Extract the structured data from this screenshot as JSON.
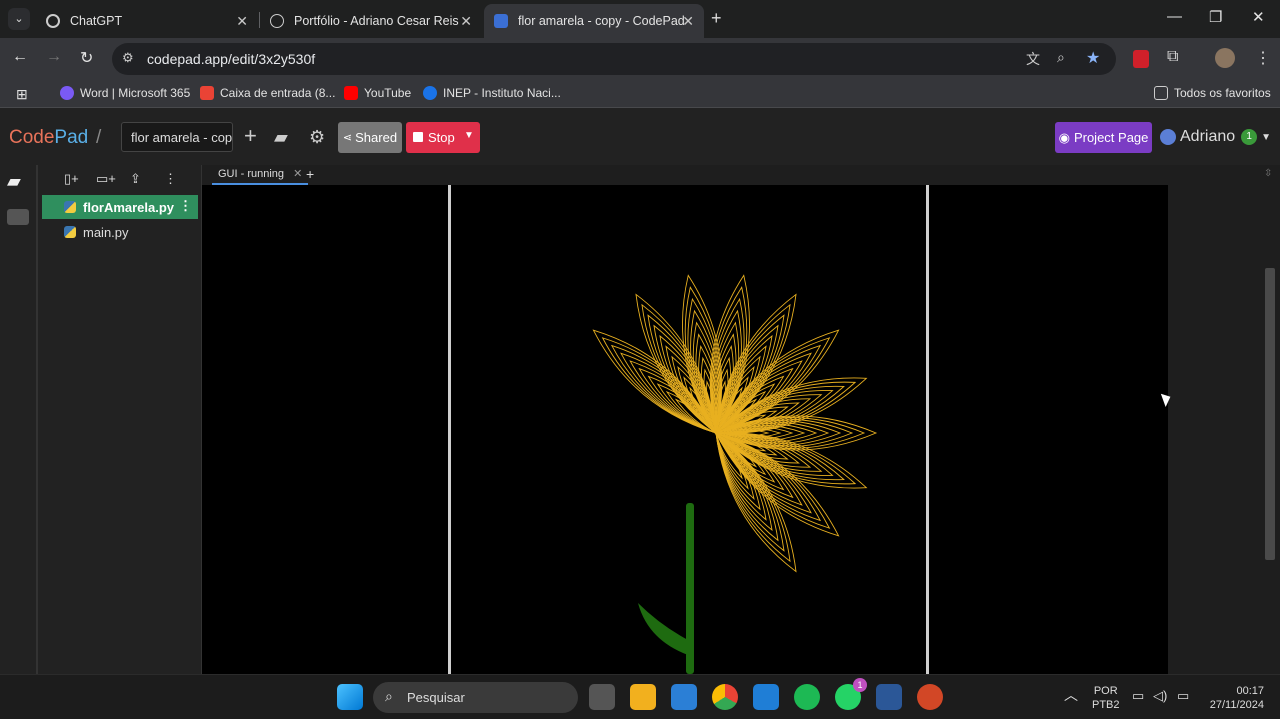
{
  "browser": {
    "tabs": [
      {
        "title": "ChatGPT",
        "icon": "chatgpt-icon"
      },
      {
        "title": "Portfólio - Adriano Cesar Reis",
        "icon": "globe-icon"
      },
      {
        "title": "flor amarela - copy - CodePad",
        "icon": "codepad-icon",
        "active": true
      }
    ],
    "url": "codepad.app/edit/3x2y530f",
    "bookmarks": [
      {
        "label": "Word | Microsoft 365",
        "color": "#7a5af5"
      },
      {
        "label": "Caixa de entrada (8...",
        "color": "#ea4335"
      },
      {
        "label": "YouTube",
        "color": "#ff0000"
      },
      {
        "label": "INEP - Instituto Naci...",
        "color": "#1a73e8"
      }
    ],
    "all_bookmarks": "Todos os favoritos"
  },
  "codepad": {
    "logo_left": "Code",
    "logo_right": "Pad",
    "slash": "/",
    "project_name": "flor amarela - copy",
    "shared_label": "Shared",
    "stop_label": "Stop",
    "project_page_label": "Project Page",
    "user_name": "Adriano",
    "user_badge": "1",
    "files": [
      {
        "name": "florAmarela.py",
        "active": true
      },
      {
        "name": "main.py",
        "active": false
      }
    ],
    "run_tab": "GUI - running"
  },
  "taskbar": {
    "search_placeholder": "Pesquisar",
    "lang_1": "POR",
    "lang_2": "PTB2",
    "time": "00:17",
    "date": "27/11/2024",
    "whatsapp_badge": "1"
  },
  "colors": {
    "petal": "#e8b020",
    "stem": "#1e6b10",
    "accent_green": "#2f8f5e",
    "stop_red": "#e0304a",
    "project_purple": "#7b3cc4"
  }
}
